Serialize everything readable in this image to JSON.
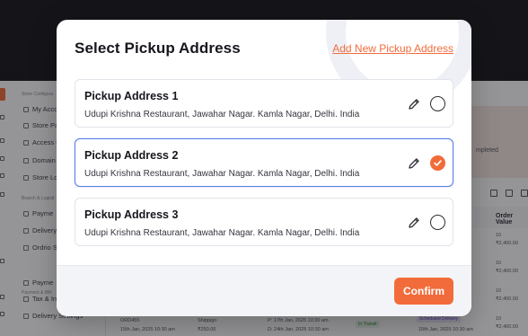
{
  "modal": {
    "title": "Select Pickup Address",
    "add_new_label": "Add New Pickup Address",
    "confirm_label": "Confirm",
    "addresses": [
      {
        "name": "Pickup Address 1",
        "address": "Udupi Krishna Restaurant, Jawahar Nagar. Kamla Nagar, Delhi. India",
        "selected": false
      },
      {
        "name": "Pickup Address 2",
        "address": "Udupi Krishna Restaurant, Jawahar Nagar. Kamla Nagar, Delhi. India",
        "selected": true
      },
      {
        "name": "Pickup Address 3",
        "address": "Udupi Krishna Restaurant, Jawahar Nagar. Kamla Nagar, Delhi. India",
        "selected": false
      }
    ]
  },
  "background": {
    "sidebar_sections": [
      "Store Configura",
      "Branch & Logisti",
      "Payment & Billi"
    ],
    "sidebar_items": [
      "My Acco",
      "Store Pa",
      "Access C",
      "Domain",
      "Store Lo",
      "Payme",
      "Delivery",
      "Ordrio S",
      "Payme",
      "Tax & In",
      "Delivery Settings"
    ],
    "banner_text": "mpleted",
    "order_value_header": "Order Value",
    "order_values": [
      "10",
      "₹2,400.00",
      "10",
      "₹2,400.00",
      "10",
      "₹2,400.00",
      "10",
      "₹2,400.00"
    ],
    "row": {
      "order_id": "ORD455",
      "order_date": "15th Jan, 2025 10:30 am",
      "carrier": "Shippigo",
      "amount": "₹250.00",
      "pickup": "P: 17th Jan, 2025 10:30 am",
      "drop": "D: 24th Jan, 2025 10:30 am",
      "status": "In Transit",
      "delivery_badge": "Scheduled Delivery",
      "delivery_date": "15th Jan, 2025 10:30 am"
    }
  },
  "colors": {
    "accent": "#f26b3a",
    "selected_border": "#5b7fe6"
  }
}
